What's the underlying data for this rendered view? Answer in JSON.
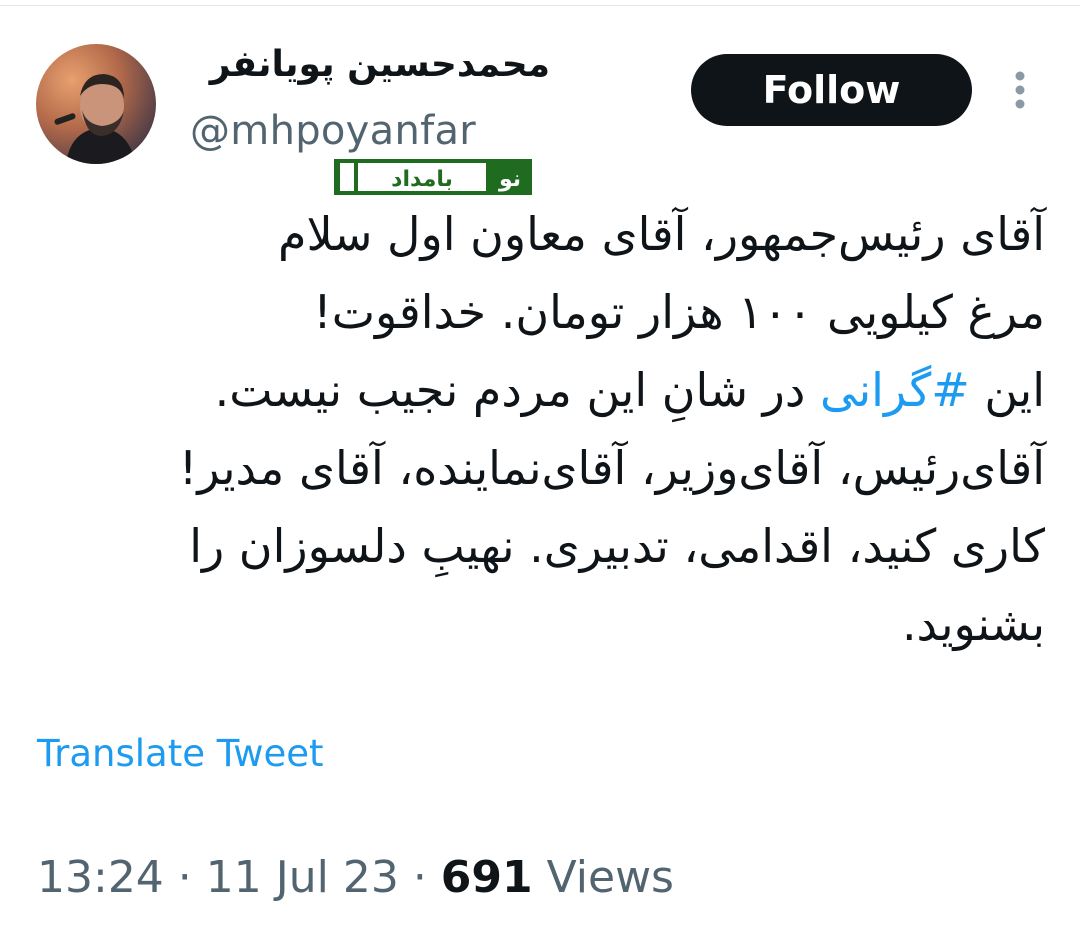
{
  "author": {
    "display_name": "محمدحسین پویانفر",
    "handle": "@mhpoyanfar"
  },
  "actions": {
    "follow_label": "Follow",
    "more_icon": "more-vertical-icon"
  },
  "watermark": {
    "text_a": "بامداد",
    "text_b": "نو"
  },
  "tweet": {
    "line1": "آقای رئیس‌جمهور، آقای معاون اول سلام",
    "line2": "مرغ کیلویی ۱۰۰ هزار تومان. خداقوت!",
    "line3_before": "این ",
    "hashtag": "#گرانی",
    "line3_after": " در شانِ این مردم نجیب نیست.",
    "line4": "آقای‌رئیس، آقای‌وزیر، آقای‌نماینده، آقای مدیر!",
    "line5": "کاری کنید، اقدامی، تدبیری. نهیبِ دلسوزان را",
    "line6": "بشنوید."
  },
  "translate_label": "Translate Tweet",
  "meta": {
    "time": "13:24",
    "sep1": " · ",
    "date": "11 Jul 23",
    "sep2": " · ",
    "views_count": "691",
    "views_label": " Views"
  },
  "colors": {
    "text": "#0f1419",
    "secondary": "#536471",
    "link": "#1d9bf0",
    "button_bg": "#0f1419",
    "watermark_green": "#1f6b1f"
  }
}
